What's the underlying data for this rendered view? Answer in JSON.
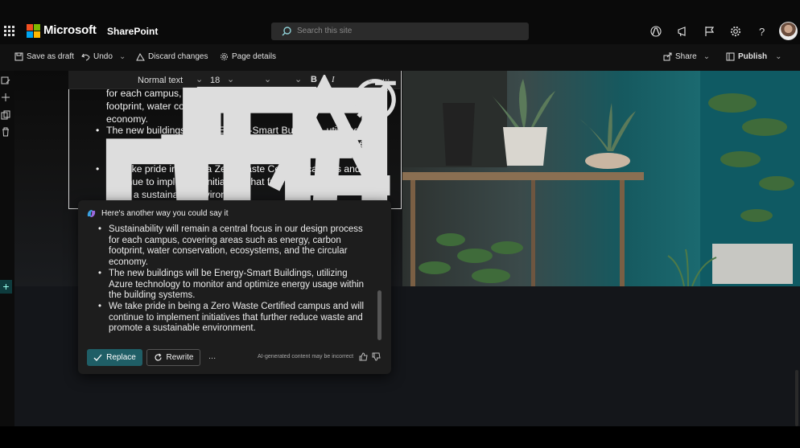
{
  "suite": {
    "brand": "Microsoft",
    "app_name": "SharePoint",
    "search_placeholder": "Search this site"
  },
  "commands": {
    "save_draft": "Save as draft",
    "undo": "Undo",
    "discard": "Discard changes",
    "page_details": "Page details",
    "share": "Share",
    "publish": "Publish"
  },
  "format_toolbar": {
    "style": "Normal text",
    "font_size": "18",
    "bold": "B",
    "italic": "I",
    "more": "..."
  },
  "text_part": {
    "partial_line_1": "for each campus, encompassing areas such as energy, carbon",
    "partial_line_2": "footprint, water conservation, ecosystems, and the circular",
    "partial_line_3": "economy.",
    "bullets": [
      "The new buildings will be Energy-Smart Buildings, utilizing Azure technology to monitor and optimize energy usage within the building systems.",
      "We take pride in being a Zero Waste Certified campus and will continue to implement initiatives that further reduce waste and foster a sustainable environment."
    ]
  },
  "copilot": {
    "heading": "Here's another way you could say it",
    "suggestions": [
      "Sustainability will remain a central focus in our design process for each campus, covering areas such as energy, carbon footprint, water conservation, ecosystems, and the circular economy.",
      "The new buildings will be Energy-Smart Buildings, utilizing Azure technology to monitor and optimize energy usage within the building systems.",
      "We take pride in being a Zero Waste Certified campus and will continue to implement initiatives that further reduce waste and promote a sustainable environment."
    ],
    "replace_label": "Replace",
    "rewrite_label": "Rewrite",
    "more_label": "...",
    "disclaimer": "AI-generated content may be incorrect"
  },
  "rail": {
    "add_section": "+"
  },
  "colors": {
    "accent": "#1f5e66",
    "background": "#14161a"
  }
}
